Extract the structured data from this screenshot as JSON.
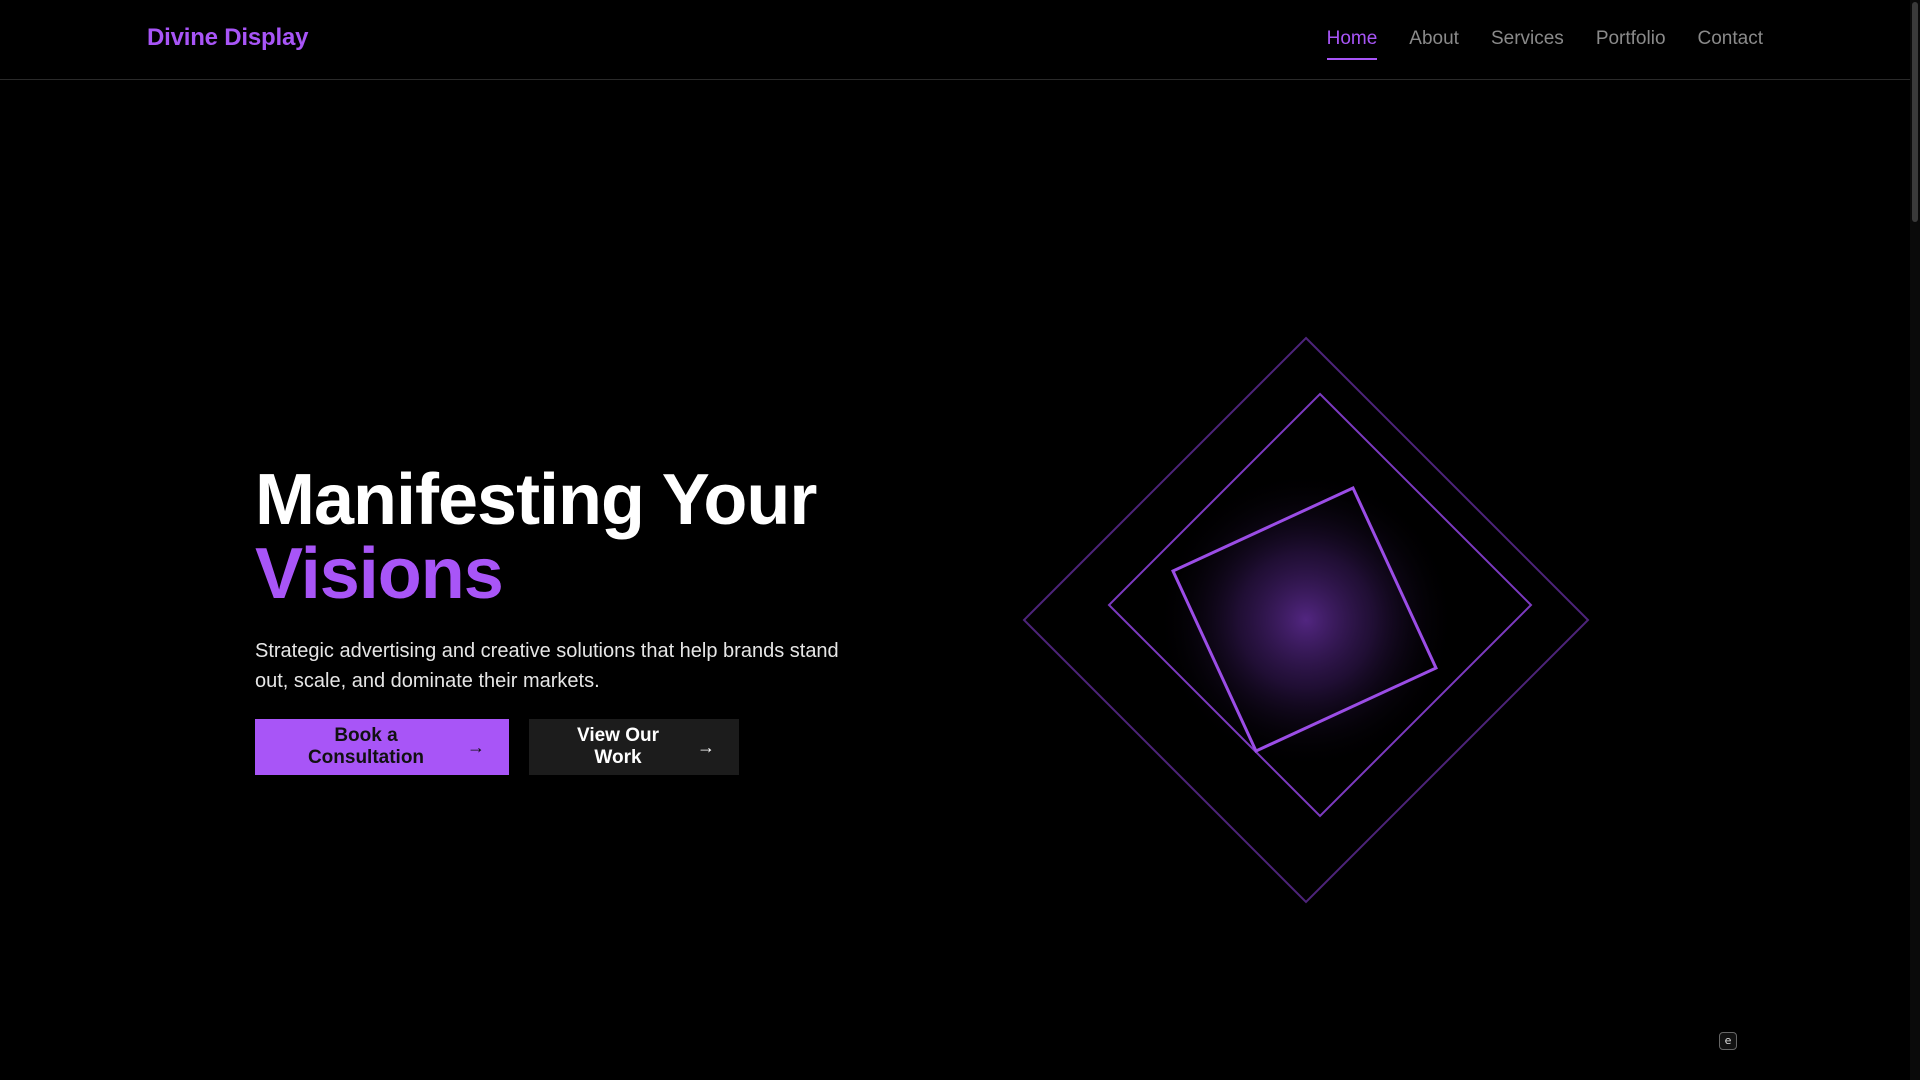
{
  "brand": {
    "name": "Divine Display"
  },
  "nav": {
    "items": [
      {
        "label": "Home",
        "active": true
      },
      {
        "label": "About",
        "active": false
      },
      {
        "label": "Services",
        "active": false
      },
      {
        "label": "Portfolio",
        "active": false
      },
      {
        "label": "Contact",
        "active": false
      }
    ]
  },
  "hero": {
    "title_line1": "Manifesting Your",
    "title_line2": "Visions",
    "subtitle": "Strategic advertising and creative solutions that help brands stand out, scale, and dominate their markets.",
    "primary_button": "Book a Consultation",
    "secondary_button": "View Our Work",
    "graphic_icon": "nested-diamonds-graphic"
  },
  "floating_badge": {
    "icon": "e-badge-icon",
    "glyph": "e"
  },
  "colors": {
    "accent": "#a855f7",
    "background": "#000000",
    "secondary_button_bg": "#1c1c1c"
  }
}
